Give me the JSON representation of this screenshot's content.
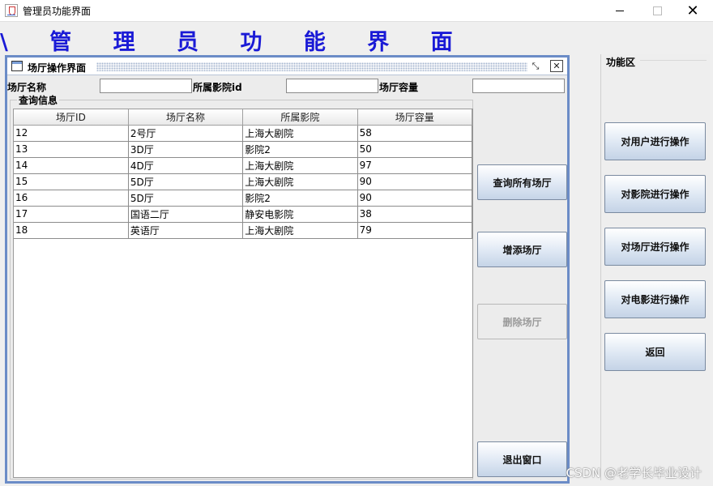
{
  "window": {
    "title": "管理员功能界面"
  },
  "header": {
    "text": "\\ 管 理 员 功 能 界 面"
  },
  "internal_frame": {
    "title": "场厅操作界面"
  },
  "form": {
    "hall_name_label": "场厅名称",
    "hall_name_value": "",
    "cinema_id_label": "所属影院id",
    "cinema_id_value": "",
    "capacity_label": "场厅容量",
    "capacity_value": ""
  },
  "query": {
    "title": "查询信息",
    "columns": [
      "场厅ID",
      "场厅名称",
      "所属影院",
      "场厅容量"
    ],
    "rows": [
      [
        "12",
        "2号厅",
        "上海大剧院",
        "58"
      ],
      [
        "13",
        "3D厅",
        "影院2",
        "50"
      ],
      [
        "14",
        "4D厅",
        "上海大剧院",
        "97"
      ],
      [
        "15",
        "5D厅",
        "上海大剧院",
        "90"
      ],
      [
        "16",
        "5D厅",
        "影院2",
        "90"
      ],
      [
        "17",
        "国语二厅",
        "静安电影院",
        "38"
      ],
      [
        "18",
        "英语厅",
        "上海大剧院",
        "79"
      ]
    ]
  },
  "actions": {
    "query_all": "查询所有场厅",
    "add": "增添场厅",
    "delete": "删除场厅",
    "exit": "退出窗口"
  },
  "function_area": {
    "title": "功能区",
    "buttons": [
      "对用户进行操作",
      "对影院进行操作",
      "对场厅进行操作",
      "对电影进行操作",
      "返回"
    ]
  },
  "watermark": "CSDN @老学长毕业设计"
}
